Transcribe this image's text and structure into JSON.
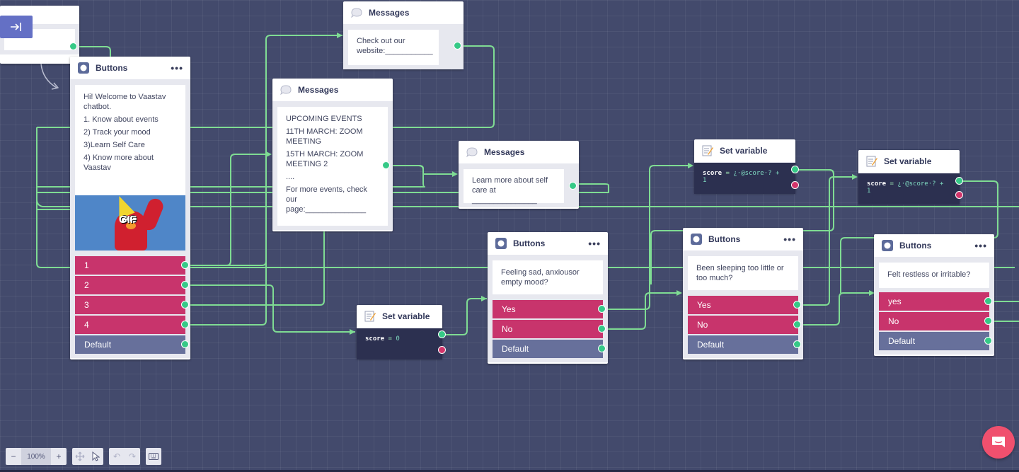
{
  "colors": {
    "canvas": "#434a6c",
    "wire": "#7fdc93",
    "port_green": "#36c987",
    "port_red": "#d2346b",
    "button_pink": "#c8346c",
    "button_default": "#67709b",
    "chat_fab": "#f0506e"
  },
  "start_node": {
    "icon": "arrow-right-to-bar-icon"
  },
  "buttons_main": {
    "title": "Buttons",
    "menu": "•••",
    "lines": [
      "Hi! Welcome to Vaastav chatbot.",
      "1. Know about events",
      "2) Track your mood",
      "3)Learn Self Care",
      "4) Know more about Vaastav"
    ],
    "gif_label": "GIF",
    "options": [
      "1",
      "2",
      "3",
      "4",
      "Default"
    ]
  },
  "msg_website": {
    "title": "Messages",
    "text": "Check out our website:___________"
  },
  "msg_events": {
    "title": "Messages",
    "lines": [
      "UPCOMING EVENTS",
      "11TH MARCH: ZOOM MEETING",
      "15TH MARCH: ZOOM MEETING 2",
      "....",
      "For more events, check our page:______________"
    ]
  },
  "msg_selfcare": {
    "title": "Messages",
    "text": "Learn more about self care at _______________"
  },
  "setvar_score0": {
    "title": "Set variable",
    "var": "score",
    "op": "=",
    "val": "0"
  },
  "buttons_sad": {
    "title": "Buttons",
    "menu": "•••",
    "text": "Feeling sad, anxiousor empty mood?",
    "options": [
      "Yes",
      "No",
      "Default"
    ]
  },
  "setvar_inc1": {
    "title": "Set variable",
    "var": "score",
    "op": "=",
    "val": "¿·@score·? + 1"
  },
  "buttons_sleep": {
    "title": "Buttons",
    "menu": "•••",
    "text": "Been sleeping too little or too much?",
    "options": [
      "Yes",
      "No",
      "Default"
    ]
  },
  "setvar_inc2": {
    "title": "Set variable",
    "var": "score",
    "op": "=",
    "val": "¿·@score·? + 1"
  },
  "buttons_restless": {
    "title": "Buttons",
    "menu": "•••",
    "text": "Felt restless or irritable?",
    "options": [
      "yes",
      "No",
      "Default"
    ]
  },
  "toolbar": {
    "zoom_out": "−",
    "zoom_level": "100%",
    "zoom_in": "+",
    "undo": "↶",
    "redo": "↷"
  }
}
